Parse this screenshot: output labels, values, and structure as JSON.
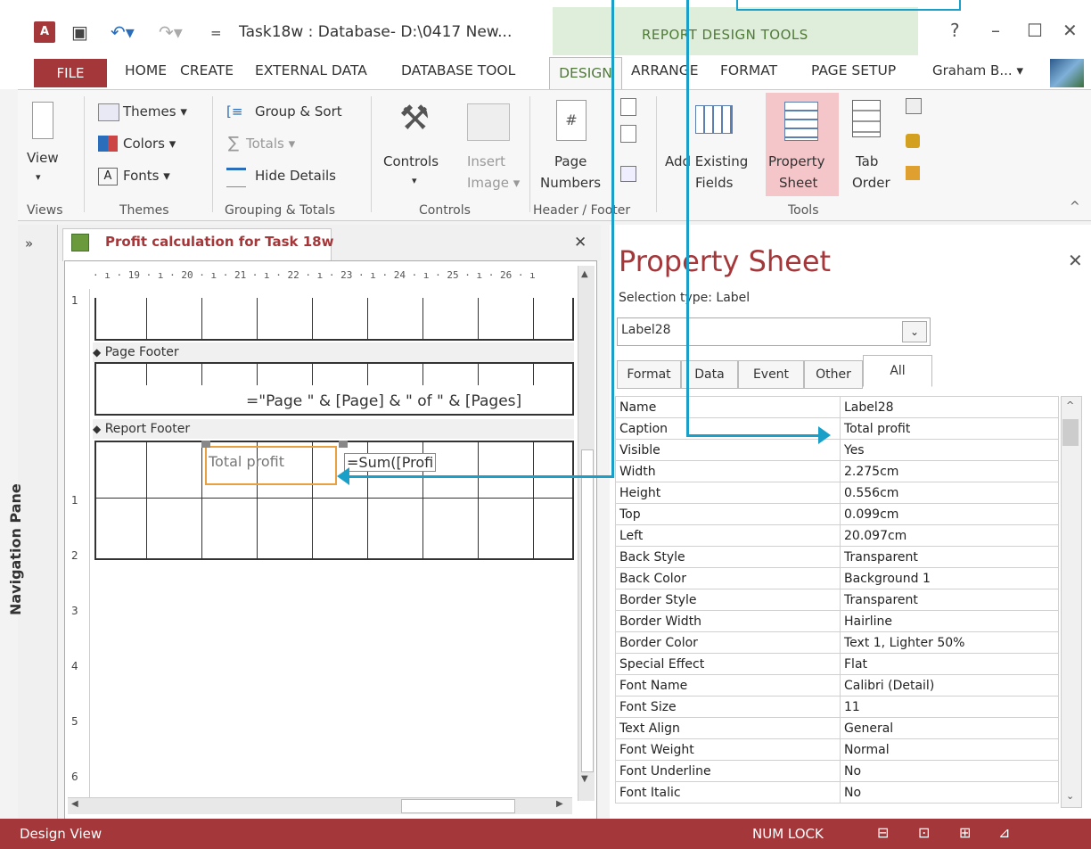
{
  "titlebar": {
    "app_icon": "A",
    "title": "Task18w : Database- D:\\0417 New...",
    "context_title": "REPORT DESIGN TOOLS",
    "help": "?",
    "minimize": "–",
    "maximize": "☐",
    "close": "✕"
  },
  "tabs": {
    "file": "FILE",
    "items": [
      "HOME",
      "CREATE",
      "EXTERNAL DATA",
      "DATABASE TOOL"
    ],
    "design": "DESIGN",
    "context_items": [
      "ARRANGE",
      "FORMAT",
      "PAGE SETUP"
    ],
    "user": "Graham B...",
    "user_dropdown": "▾"
  },
  "ribbon": {
    "views": {
      "view": "View",
      "arrow": "▾",
      "group": "Views"
    },
    "themes": {
      "themes": "Themes ▾",
      "colors": "Colors ▾",
      "fonts": "Fonts ▾",
      "group": "Themes"
    },
    "grouping": {
      "group_sort": "Group & Sort",
      "totals": "Totals ▾",
      "hide_details": "Hide Details",
      "group": "Grouping & Totals"
    },
    "controls": {
      "controls": "Controls",
      "controls_arrow": "▾",
      "insert": "Insert",
      "image": "Image ▾",
      "group": "Controls"
    },
    "header": {
      "page": "Page",
      "numbers": "Numbers",
      "group": "Header / Footer"
    },
    "tools": {
      "add": "Add Existing",
      "fields": "Fields",
      "property": "Property",
      "sheet": "Sheet",
      "tab": "Tab",
      "order": "Order",
      "group": "Tools"
    },
    "collapse": "^"
  },
  "nav": {
    "expand": "»",
    "label": "Navigation Pane"
  },
  "document": {
    "tab_title": "Profit calculation for Task 18w",
    "close": "✕",
    "ruler": "· ı · 19 · ı · 20 · ı · 21 · ı · 22 · ı · 23 · ı · 24 · ı · 25 · ı · 26 · ı",
    "vruler_numbers": [
      "1",
      "1",
      "2",
      "3",
      "4",
      "5",
      "6"
    ],
    "page_footer": "Page Footer",
    "page_expr": "=\"Page \" & [Page] & \" of \" & [Pages]",
    "report_footer": "Report Footer",
    "label_text": "Total profit",
    "sum_expr": "=Sum([Profi"
  },
  "property_sheet": {
    "title": "Property Sheet",
    "close": "✕",
    "selection": "Selection type:  Label",
    "dropdown_value": "Label28",
    "dropdown_arrow": "⌄",
    "tabs": [
      "Format",
      "Data",
      "Event",
      "Other",
      "All"
    ],
    "rows": [
      [
        "Name",
        "Label28"
      ],
      [
        "Caption",
        "Total profit"
      ],
      [
        "Visible",
        "Yes"
      ],
      [
        "Width",
        "2.275cm"
      ],
      [
        "Height",
        "0.556cm"
      ],
      [
        "Top",
        "0.099cm"
      ],
      [
        "Left",
        "20.097cm"
      ],
      [
        "Back Style",
        "Transparent"
      ],
      [
        "Back Color",
        "Background 1"
      ],
      [
        "Border Style",
        "Transparent"
      ],
      [
        "Border Width",
        "Hairline"
      ],
      [
        "Border Color",
        "Text 1, Lighter 50%"
      ],
      [
        "Special Effect",
        "Flat"
      ],
      [
        "Font Name",
        "Calibri (Detail)"
      ],
      [
        "Font Size",
        "11"
      ],
      [
        "Text Align",
        "General"
      ],
      [
        "Font Weight",
        "Normal"
      ],
      [
        "Font Underline",
        "No"
      ],
      [
        "Font Italic",
        "No"
      ]
    ]
  },
  "status": {
    "left": "Design View",
    "numlock": "NUM LOCK"
  },
  "colors": {
    "accent": "#a4373a",
    "context": "#4e7a36",
    "arrow": "#1aa0c8",
    "selection": "#e8a040"
  }
}
